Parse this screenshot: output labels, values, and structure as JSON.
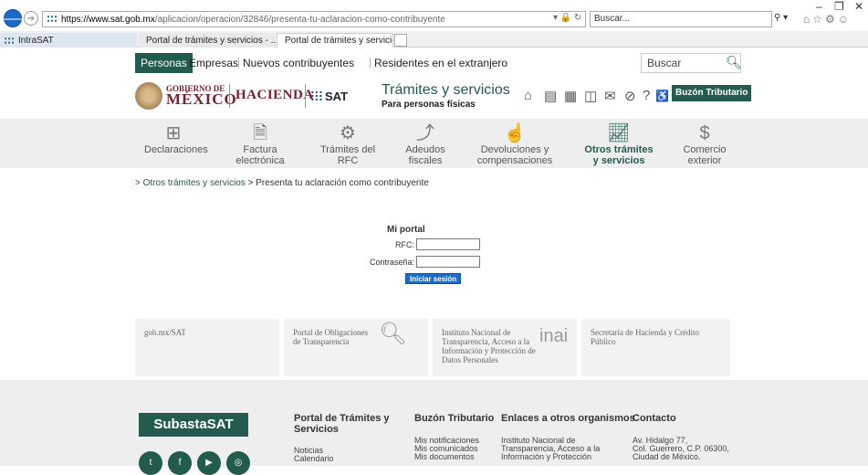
{
  "browser": {
    "url_host": "https://www.sat.gob.mx",
    "url_rest": "/aplicacion/operacion/32846/presenta-tu-aclaracion-como-contribuyente",
    "search_placeholder": "Buscar...",
    "tabs": [
      {
        "label": "IntraSAT"
      },
      {
        "label": "Portal de trámites y servicios - ..."
      },
      {
        "label": "Portal de trámites y servicio... ×"
      }
    ]
  },
  "topnav": {
    "items": [
      "Personas",
      "Empresas",
      "Nuevos contribuyentes",
      "Residentes en el extranjero"
    ],
    "search_label": "Buscar"
  },
  "brand": {
    "gob_small": "GOBIERNO DE",
    "gob_big": "MÉXICO",
    "hacienda": "HACIENDA",
    "sat": "SAT",
    "title": "Trámites y servicios",
    "subtitle": "Para personas físicas",
    "buzon": "Buzón Tributario"
  },
  "categories": [
    {
      "label1": "Declaraciones",
      "label2": ""
    },
    {
      "label1": "Factura",
      "label2": "electrónica"
    },
    {
      "label1": "Trámites del",
      "label2": "RFC"
    },
    {
      "label1": "Adeudos",
      "label2": "fiscales"
    },
    {
      "label1": "Devoluciones y",
      "label2": "compensaciones"
    },
    {
      "label1": "Otros trámites",
      "label2": "y servicios"
    },
    {
      "label1": "Comercio",
      "label2": "exterior"
    }
  ],
  "breadcrumb": {
    "link": "> Otros trámites y servicios",
    "current": " > Presenta tu aclaración como contribuyente"
  },
  "login": {
    "title": "Mi portal",
    "rfc_label": "RFC:",
    "password_label": "Contraseña:",
    "button": "Iniciar sesión"
  },
  "links": {
    "gob": "gob.mx/SAT",
    "trans": "Portal de Obligaciones de Transparencia",
    "inai": "Instituto Nacional de Transparencia, Acceso a la Información y Protección de Datos Personales",
    "inai_logo": "inai",
    "shcp": "Secretaría de Hacienda y Crédito Público"
  },
  "footer": {
    "subasta": "SubastaSAT",
    "col1_head": "Portal de Trámites y Servicios",
    "col1_links": [
      "Noticias",
      "Calendario"
    ],
    "col2_head": "Buzón Tributario",
    "col2_links": [
      "Mis notificaciones",
      "Mis comunicados",
      "Mis documentos"
    ],
    "col3_head": "Enlaces a otros organismos",
    "col3_links": [
      "Instituto Nacional de",
      "Transparencia, Acceso a la",
      "Información y Protección"
    ],
    "col4_head": "Contacto",
    "col4_links": [
      "Av. Hidalgo 77,",
      "Col. Guerrero, C.P. 06300,",
      "Ciudad de México."
    ]
  },
  "colors": {
    "brand_green": "#235b4e",
    "brand_wine": "#7b1e2e",
    "ie_blue": "#1e6ac8"
  }
}
